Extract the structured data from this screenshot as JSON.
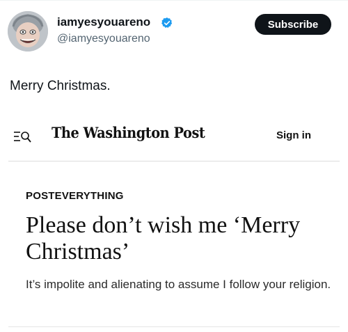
{
  "tweet": {
    "display_name": "iamyesyouareno",
    "handle": "@iamyesyouareno",
    "subscribe_label": "Subscribe",
    "text": "Merry Christmas.",
    "avatar_icon": "avatar-caricature",
    "verified_icon": "verified-badge-icon",
    "verified_color": "#1d9bf0"
  },
  "article": {
    "publication": "The Washington Post",
    "sign_in_label": "Sign in",
    "menu_icon": "menu-search-icon",
    "kicker": "POSTEVERYTHING",
    "headline": "Please don’t wish me ‘Merry Christmas’",
    "subhead": "It’s impolite and alienating to assume I follow your religion."
  }
}
